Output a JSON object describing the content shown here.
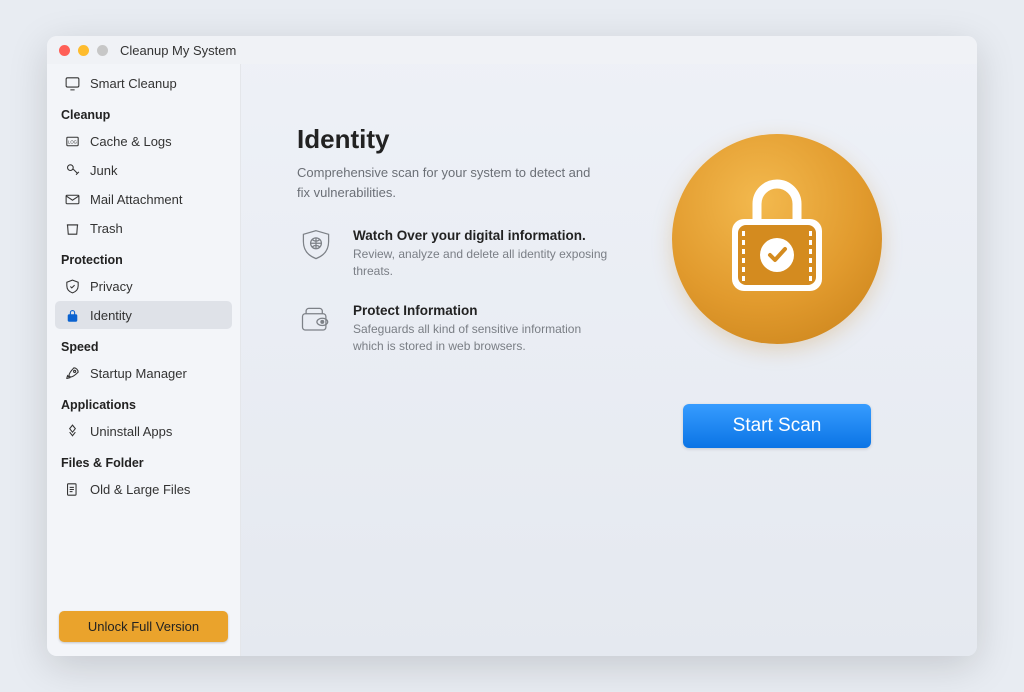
{
  "window": {
    "title": "Cleanup My System"
  },
  "sidebar": {
    "top_item": {
      "label": "Smart Cleanup"
    },
    "sections": [
      {
        "title": "Cleanup",
        "items": [
          {
            "id": "cache",
            "label": "Cache & Logs"
          },
          {
            "id": "junk",
            "label": "Junk"
          },
          {
            "id": "mail",
            "label": "Mail Attachment"
          },
          {
            "id": "trash",
            "label": "Trash"
          }
        ]
      },
      {
        "title": "Protection",
        "items": [
          {
            "id": "privacy",
            "label": "Privacy"
          },
          {
            "id": "identity",
            "label": "Identity",
            "selected": true
          }
        ]
      },
      {
        "title": "Speed",
        "items": [
          {
            "id": "startup",
            "label": "Startup Manager"
          }
        ]
      },
      {
        "title": "Applications",
        "items": [
          {
            "id": "uninstall",
            "label": "Uninstall Apps"
          }
        ]
      },
      {
        "title": "Files & Folder",
        "items": [
          {
            "id": "oldlarge",
            "label": "Old & Large Files"
          }
        ]
      }
    ],
    "unlock_label": "Unlock Full Version"
  },
  "main": {
    "title": "Identity",
    "subtitle": "Comprehensive scan for your system to detect and fix vulnerabilities.",
    "features": [
      {
        "title": "Watch Over your digital information.",
        "desc": "Review, analyze and delete all identity exposing threats."
      },
      {
        "title": "Protect Information",
        "desc": "Safeguards all kind of sensitive information which is stored in web browsers."
      }
    ],
    "scan_button": "Start Scan"
  }
}
